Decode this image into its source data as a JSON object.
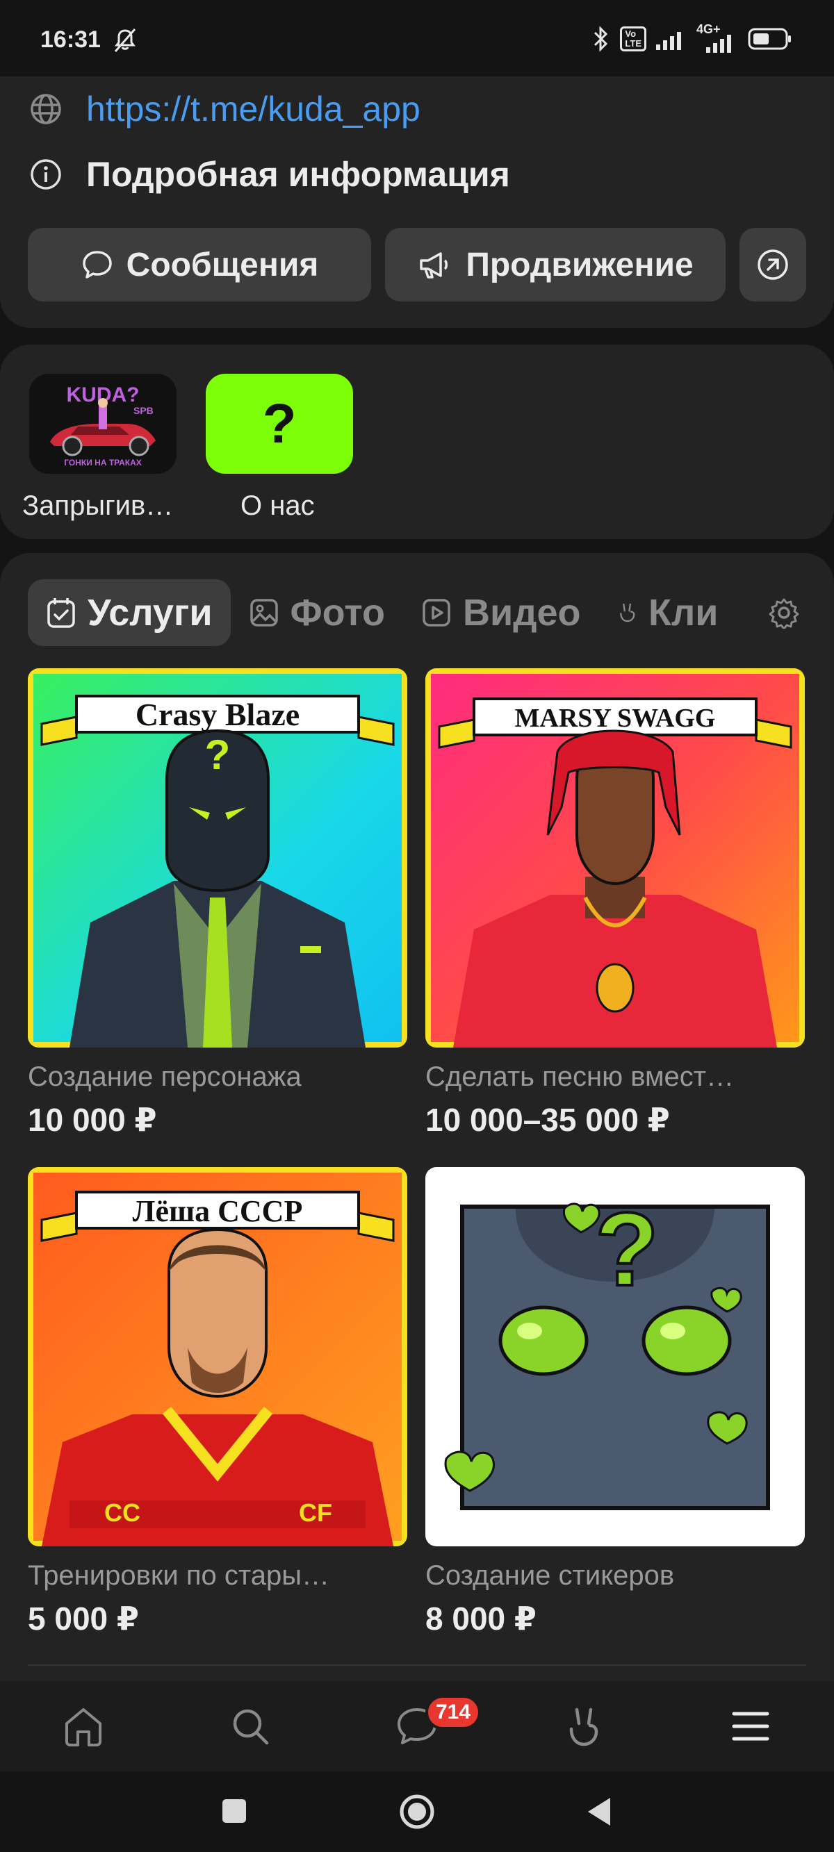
{
  "status": {
    "time": "16:31",
    "network": "4G+"
  },
  "links": {
    "url": "https://t.me/kuda_app",
    "details": "Подробная информация"
  },
  "actions": {
    "messages": "Сообщения",
    "promotion": "Продвижение"
  },
  "stories": [
    {
      "label": "Запрыгив…",
      "logo_text": "KUDA?",
      "logo_sub": "SPB",
      "logo_caption": "ГОНКИ НА ТРАКАХ"
    },
    {
      "label": "О нас",
      "glyph": "?"
    }
  ],
  "tabs": [
    {
      "label": "Услуги",
      "icon": "calendar-check-icon",
      "active": true
    },
    {
      "label": "Фото",
      "icon": "image-icon"
    },
    {
      "label": "Видео",
      "icon": "play-icon"
    },
    {
      "label": "Кли",
      "icon": "clip-icon"
    }
  ],
  "products": [
    {
      "title": "Создание персонажа",
      "price": "10 000 ₽",
      "banner": "Crasy Blaze"
    },
    {
      "title": "Сделать песню вмест…",
      "price": "10 000–35 000 ₽",
      "banner": "MARSY SWAGG"
    },
    {
      "title": "Тренировки по стары…",
      "price": "5 000 ₽",
      "banner": "Лёша СССР"
    },
    {
      "title": "Создание стикеров",
      "price": "8 000 ₽"
    }
  ],
  "bottom_nav": {
    "messages_badge": "714"
  },
  "colors": {
    "link": "#4a9cf0",
    "badge": "#e8372f",
    "story_green": "#7dff0a"
  }
}
